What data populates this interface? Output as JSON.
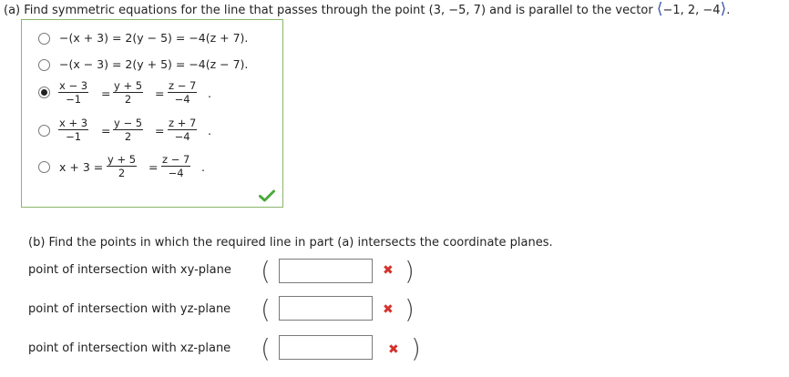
{
  "question_a": {
    "prefix": "(a) Find symmetric equations for the line that passes through the point",
    "point": "(3, −5, 7)",
    "middle": "and is parallel to the vector",
    "vector_left": "⟨",
    "vector_values": "−1, 2, −4",
    "vector_right": "⟩",
    "end": "."
  },
  "options": [
    {
      "text": "−(x + 3) = 2(y − 5) = −4(z + 7).",
      "selected": false
    },
    {
      "text": "−(x − 3) = 2(y + 5) = −4(z − 7).",
      "selected": false
    },
    {
      "num1": "x − 3",
      "den1": "−1",
      "num2": "y + 5",
      "den2": "2",
      "num3": "z − 7",
      "den3": "−4",
      "selected": true
    },
    {
      "num1": "x + 3",
      "den1": "−1",
      "num2": "y − 5",
      "den2": "2",
      "num3": "z + 7",
      "den3": "−4",
      "selected": false
    },
    {
      "lead": "x + 3 =",
      "num2": "y + 5",
      "den2": "2",
      "num3": "z − 7",
      "den3": "−4",
      "selected": false
    }
  ],
  "symbols": {
    "eq": "=",
    "period": "."
  },
  "question_b": "(b) Find the points in which the required line in part (a) intersects the coordinate planes.",
  "rows": [
    {
      "label": "point of intersection with xy-plane",
      "value": ""
    },
    {
      "label": "point of intersection with yz-plane",
      "value": ""
    },
    {
      "label": "point of intersection with xz-plane",
      "value": ""
    }
  ],
  "glyphs": {
    "open_paren": "(",
    "close_paren": ")",
    "x_mark": "✖"
  },
  "colors": {
    "box_border": "#8ab56b",
    "check": "#4caa3c",
    "x_mark": "#d4322c",
    "vector": "#3a56a6"
  }
}
